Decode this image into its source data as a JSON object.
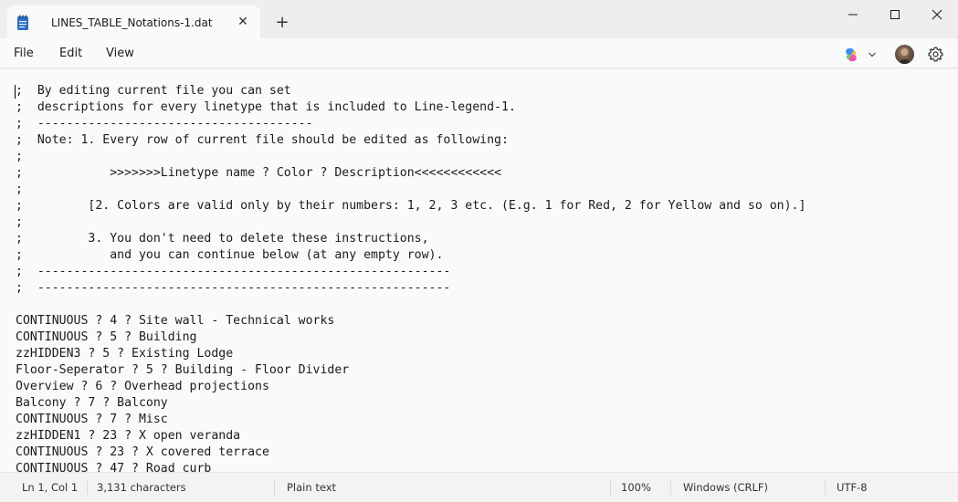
{
  "window": {
    "tab_title": "LINES_TABLE_Notations-1.dat",
    "new_tab_glyph": "+",
    "close_tab_glyph": "✕"
  },
  "menu": {
    "file": "File",
    "edit": "Edit",
    "view": "View"
  },
  "toolbar_icons": [
    "copilot-icon",
    "chevron-down-icon",
    "avatar",
    "gear-icon"
  ],
  "editor": {
    "lines": [
      ";  By editing current file you can set",
      ";  descriptions for every linetype that is included to Line-legend-1.",
      ";  --------------------------------------",
      ";  Note: 1. Every row of current file should be edited as following:",
      ";",
      ";            >>>>>>>Linetype name ? Color ? Description<<<<<<<<<<<<",
      ";",
      ";         [2. Colors are valid only by their numbers: 1, 2, 3 etc. (E.g. 1 for Red, 2 for Yellow and so on).]",
      ";",
      ";         3. You don't need to delete these instructions,",
      ";            and you can continue below (at any empty row).",
      ";  ---------------------------------------------------------",
      ";  ---------------------------------------------------------",
      "",
      "CONTINUOUS ? 4 ? Site wall - Technical works",
      "CONTINUOUS ? 5 ? Building",
      "zzHIDDEN3 ? 5 ? Existing Lodge",
      "Floor-Seperator ? 5 ? Building - Floor Divider",
      "Overview ? 6 ? Overhead projections",
      "Balcony ? 7 ? Balcony",
      "CONTINUOUS ? 7 ? Misc",
      "zzHIDDEN1 ? 23 ? X open veranda",
      "CONTINUOUS ? 23 ? X covered terrace",
      "CONTINUOUS ? 47 ? Road curb"
    ]
  },
  "status": {
    "position": "Ln 1, Col 1",
    "characters": "3,131 characters",
    "format": "Plain text",
    "zoom": "100%",
    "line_ending": "Windows (CRLF)",
    "encoding": "UTF-8"
  },
  "colors": {
    "accent_doc_icon": "#2b6fbf",
    "editor_bg": "#fafafa",
    "chrome_bg": "#eeeeee"
  }
}
